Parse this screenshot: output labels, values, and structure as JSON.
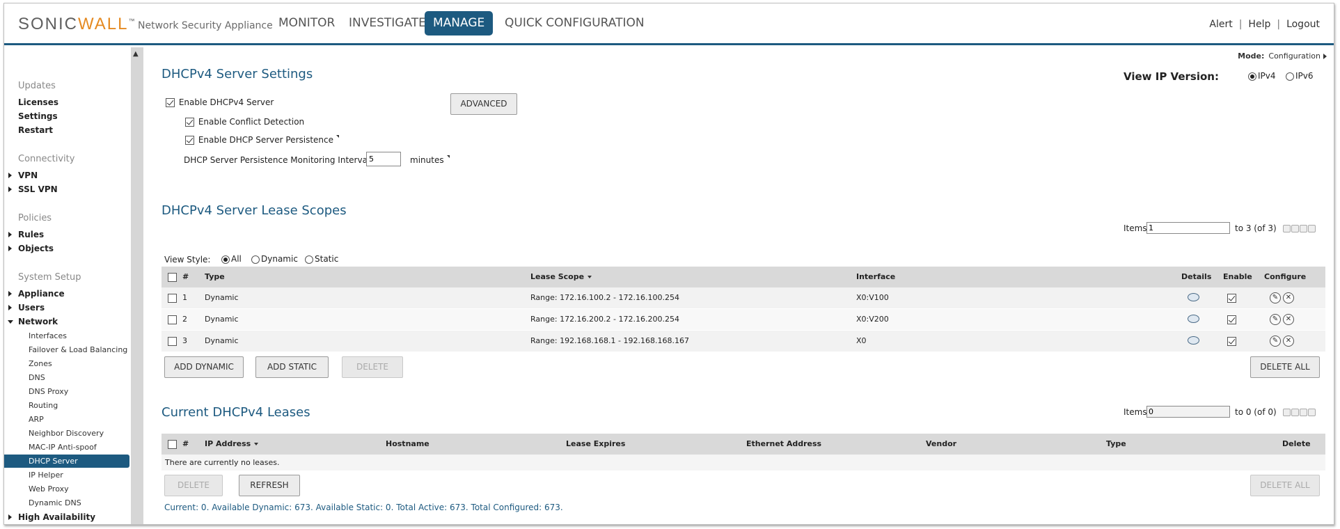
{
  "header": {
    "logo_main": "SONIC",
    "logo_accent": "WALL",
    "logo_tm": "™",
    "app_name": "Network Security Appliance",
    "nav": [
      "MONITOR",
      "INVESTIGATE",
      "MANAGE",
      "QUICK CONFIGURATION"
    ],
    "active_nav": "MANAGE",
    "links": [
      "Alert",
      "Help",
      "Logout"
    ]
  },
  "sidebar": {
    "groups": [
      {
        "label": "Updates",
        "items": [
          "Licenses",
          "Settings",
          "Restart"
        ]
      },
      {
        "label": "Connectivity",
        "items": [
          "VPN",
          "SSL VPN"
        ]
      },
      {
        "label": "Policies",
        "items": [
          "Rules",
          "Objects"
        ]
      },
      {
        "label": "System Setup",
        "items": [
          "Appliance",
          "Users",
          "Network"
        ]
      }
    ],
    "network_sub": [
      "Interfaces",
      "Failover & Load Balancing",
      "Zones",
      "DNS",
      "DNS Proxy",
      "Routing",
      "ARP",
      "Neighbor Discovery",
      "MAC-IP Anti-spoof",
      "DHCP Server",
      "IP Helper",
      "Web Proxy",
      "Dynamic DNS"
    ],
    "active_sub": "DHCP Server",
    "last_item": "High Availability"
  },
  "mode": {
    "label": "Mode:",
    "value": "Configuration"
  },
  "settings": {
    "title": "DHCPv4 Server Settings",
    "enable_server": "Enable DHCPv4 Server",
    "advanced_button": "ADVANCED",
    "conflict_detection": "Enable Conflict Detection",
    "persistence": "Enable DHCP Server Persistence",
    "interval_label": "DHCP Server Persistence Monitoring Interval:",
    "interval_value": "5",
    "interval_unit": "minutes",
    "ip_version_label": "View IP Version:",
    "ipv4": "IPv4",
    "ipv6": "IPv6",
    "ip_version_selected": "IPv4"
  },
  "scopes": {
    "title": "DHCPv4 Server Lease Scopes",
    "items_label": "Items",
    "items_value": "1",
    "range_text": "to 3 (of 3)",
    "view_style_label": "View Style:",
    "view_options": [
      "All",
      "Dynamic",
      "Static"
    ],
    "view_selected": "All",
    "columns": [
      "#",
      "Type",
      "Lease Scope",
      "Interface",
      "Details",
      "Enable",
      "Configure"
    ],
    "rows": [
      {
        "num": "1",
        "type": "Dynamic",
        "scope": "Range: 172.16.100.2 - 172.16.100.254",
        "iface": "X0:V100",
        "enabled": true
      },
      {
        "num": "2",
        "type": "Dynamic",
        "scope": "Range: 172.16.200.2 - 172.16.200.254",
        "iface": "X0:V200",
        "enabled": true
      },
      {
        "num": "3",
        "type": "Dynamic",
        "scope": "Range: 192.168.168.1 - 192.168.168.167",
        "iface": "X0",
        "enabled": true
      }
    ],
    "add_dynamic": "ADD DYNAMIC",
    "add_static": "ADD STATIC",
    "delete": "DELETE",
    "delete_all": "DELETE ALL"
  },
  "leases": {
    "title": "Current DHCPv4 Leases",
    "items_label": "Items",
    "items_value": "0",
    "range_text": "to 0 (of 0)",
    "columns": [
      "#",
      "IP Address",
      "Hostname",
      "Lease Expires",
      "Ethernet Address",
      "Vendor",
      "Type",
      "Delete"
    ],
    "empty_text": "There are currently no leases.",
    "delete": "DELETE",
    "refresh": "REFRESH",
    "delete_all": "DELETE ALL",
    "status": "Current: 0. Available Dynamic: 673. Available Static: 0. Total Active: 673. Total Configured: 673."
  }
}
